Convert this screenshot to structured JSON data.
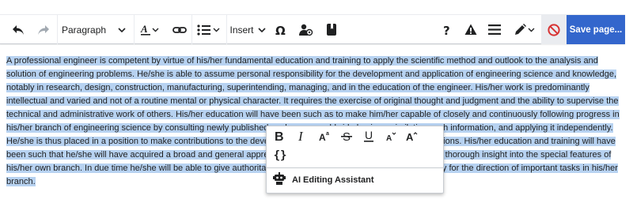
{
  "toolbar": {
    "format_label": "Paragraph",
    "insert_label": "Insert",
    "save_label": "Save page..."
  },
  "content": {
    "paragraph": "A professional engineer is competent by virtue of his/her fundamental education and training to apply the scientific method and outlook to the analysis and solution of engineering problems. He/she is able to assume personal responsibility for the development and application of engineering science and knowledge, notably in research, design, construction, manufacturing, superintending, managing, and in the education of the engineer. His/her work is predominantly intellectual and varied and not of a routine mental or physical character. It requires the exercise of original thought and judgment and the ability to supervise the technical and administrative work of others. His/her education will have been such as to make him/her capable of closely and continuously following progress in his/her branch of engineering science by consulting newly published works on a worldwide basis, assimilating such information, and applying it independently. He/she is thus placed in a position to make contributions to the development of engineering science or its applications. His/her education and training will have been such that he/she will have acquired a broad and general appreciation of the engineering sciences as well as thorough insight into the special features of his/her own branch. In due time he/she will be able to give authoritative technical advice and assume responsibility for the direction of important tasks in his/her branch."
  },
  "popup": {
    "code_label": "{}",
    "ai_assistant_label": "AI Editing Assistant"
  },
  "colors": {
    "accent": "#3366cc",
    "selection": "#b7d2f1",
    "disabled_icon": "#d73333"
  }
}
